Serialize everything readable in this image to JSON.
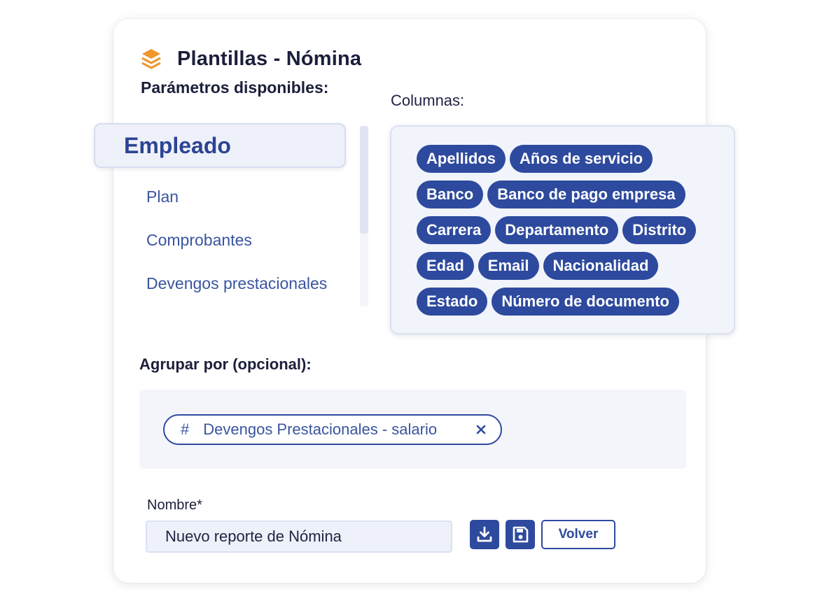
{
  "header": {
    "title": "Plantillas - Nómina",
    "icon": "layers-icon",
    "icon_color": "#f0962a"
  },
  "parameters": {
    "label": "Parámetros disponibles:",
    "categories": [
      {
        "label": "Empleado",
        "active": true
      },
      {
        "label": "Plan",
        "active": false
      },
      {
        "label": "Comprobantes",
        "active": false
      },
      {
        "label": "Devengos prestacionales",
        "active": false
      }
    ]
  },
  "columns": {
    "label": "Columnas:",
    "chips": [
      "Apellidos",
      "Años de servicio",
      "Banco",
      "Banco de pago empresa",
      "Carrera",
      "Departamento",
      "Distrito",
      "Edad",
      "Email",
      "Nacionalidad",
      "Estado",
      "Número de documento"
    ]
  },
  "group_by": {
    "label": "Agrupar por (opcional):",
    "chip": {
      "prefix": "#",
      "label": "Devengos Prestacionales - salario",
      "remove_icon": "close-icon"
    }
  },
  "name_field": {
    "label": "Nombre*",
    "value": "Nuevo reporte de Nómina"
  },
  "actions": {
    "download_icon": "download-icon",
    "save_icon": "save-icon",
    "back_label": "Volver"
  },
  "colors": {
    "accent": "#2e4a9e",
    "title_text": "#1b1f3b",
    "link_text": "#3a55a0",
    "panel_bg": "#f1f4fb"
  }
}
